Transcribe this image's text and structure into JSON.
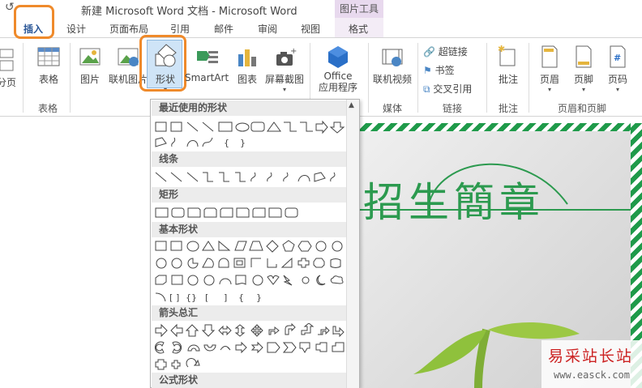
{
  "titlebar": {
    "title": "新建 Microsoft Word 文档 - Microsoft Word",
    "picture_tools": "图片工具"
  },
  "tabs": [
    {
      "label": "插入"
    },
    {
      "label": "设计"
    },
    {
      "label": "页面布局"
    },
    {
      "label": "引用"
    },
    {
      "label": "邮件"
    },
    {
      "label": "审阅"
    },
    {
      "label": "视图"
    },
    {
      "label": "格式"
    }
  ],
  "ribbon": {
    "buttons": {
      "page_break": "分页",
      "table": "表格",
      "picture": "图片",
      "online_picture": "联机图片",
      "shapes": "形状",
      "smartart": "SmartArt",
      "chart": "图表",
      "screenshot": "屏幕截图",
      "office_apps_1": "Office",
      "office_apps_2": "应用程序",
      "online_video": "联机视频",
      "hyperlink": "超链接",
      "bookmark": "书签",
      "cross_ref": "交叉引用",
      "comment": "批注",
      "header": "页眉",
      "footer": "页脚",
      "page_number": "页码"
    },
    "groups": {
      "tables": "表格",
      "media": "媒体",
      "links": "链接",
      "comments": "批注",
      "header_footer": "页眉和页脚"
    }
  },
  "shapes_menu": {
    "sections": {
      "recent": "最近使用的形状",
      "lines": "线条",
      "rect": "矩形",
      "basic": "基本形状",
      "arrows": "箭头总汇",
      "equation": "公式形状"
    }
  },
  "document": {
    "heading": "招生簡章"
  },
  "watermark": {
    "title": "易采站长站",
    "url": "www.easck.com"
  }
}
